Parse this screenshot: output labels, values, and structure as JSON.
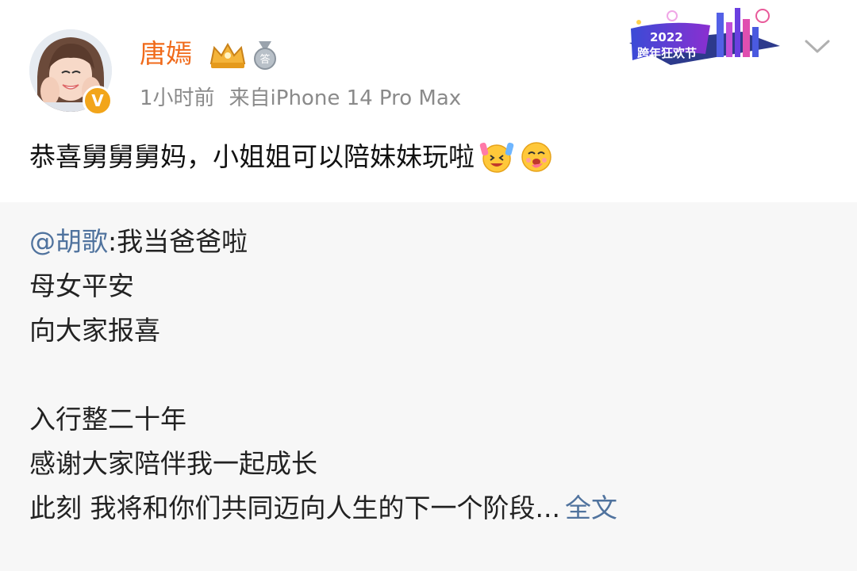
{
  "author": {
    "name": "唐嫣",
    "avatar_icon": "avatar-photo",
    "verified_badge": "V",
    "badges": [
      "crown-badge-icon",
      "medal-badge-icon"
    ],
    "medal_badge_char": "答"
  },
  "meta": {
    "time": "1小时前",
    "source": "来自iPhone 14 Pro Max"
  },
  "event_banner": {
    "year": "2022",
    "title": "跨年狂欢节"
  },
  "post": {
    "text": "恭喜舅舅舅妈，小姐姐可以陪妹妹玩啦",
    "emojis": [
      "cheering-emoji-icon",
      "hug-emoji-icon"
    ]
  },
  "repost": {
    "mention": "@胡歌",
    "first_line_rest": ":我当爸爸啦",
    "lines": [
      "母女平安",
      "向大家报喜",
      "",
      "入行整二十年",
      "感谢大家陪伴我一起成长",
      "此刻 我将和你们共同迈向人生的下一个阶段..."
    ],
    "more_link": "全文"
  },
  "colors": {
    "username": "#f06a1a",
    "link": "#50739e",
    "meta": "#8a8a8a",
    "repost_bg": "#f7f7f7",
    "verified": "#f2a51a"
  }
}
